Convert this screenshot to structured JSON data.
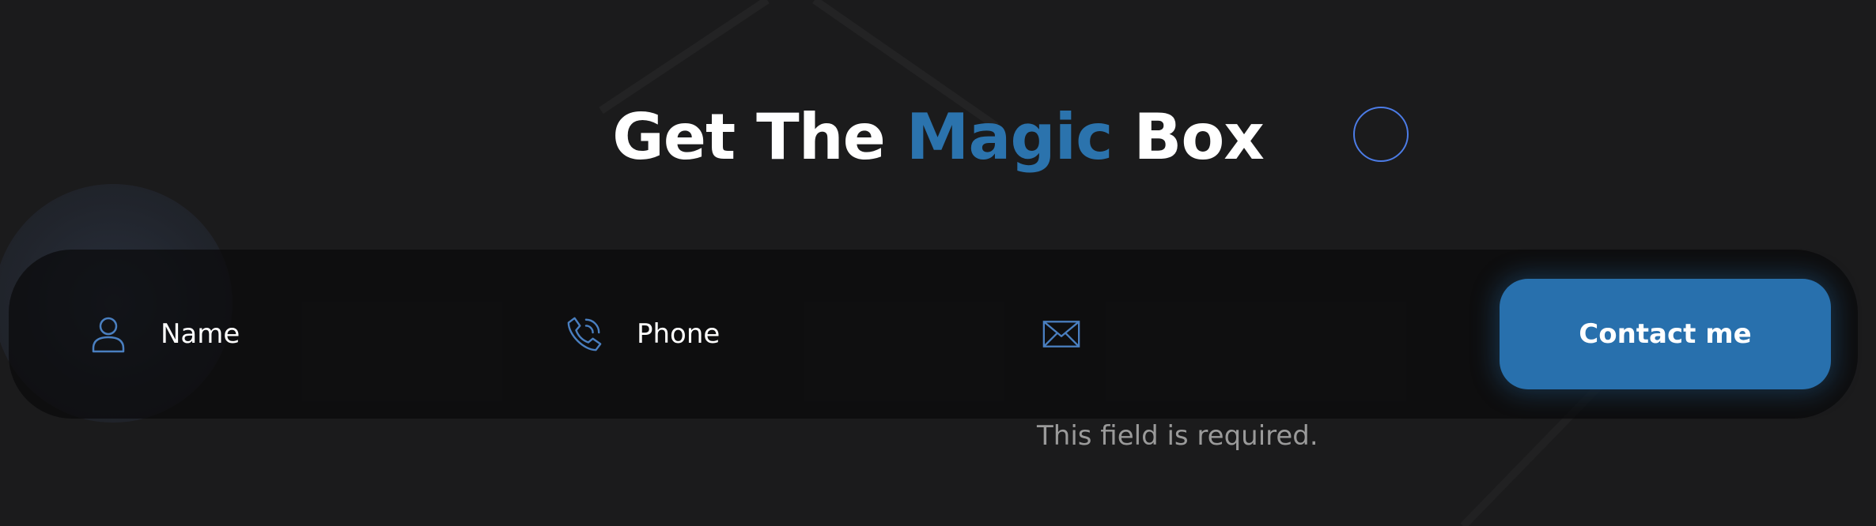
{
  "heading": {
    "part1": "Get The ",
    "accent": "Magic",
    "part2": " Box"
  },
  "form": {
    "name_label": "Name",
    "phone_label": "Phone",
    "email_label": "",
    "submit_label": "Contact me",
    "error_text": "This field is required."
  },
  "icons": {
    "name": "user-icon",
    "phone": "phone-icon",
    "email": "envelope-icon",
    "badge": "ring-icon"
  },
  "colors": {
    "background": "#1b1b1c",
    "accent": "#2b73ad",
    "button": "#2870ad",
    "icon_stroke": "#4a7fc0",
    "ring": "#4c7ce6",
    "error_text": "#9a9a9a"
  }
}
